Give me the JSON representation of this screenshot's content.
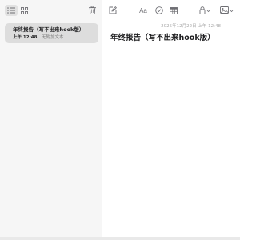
{
  "sidebar": {
    "toolbar": {
      "list_view_icon": "list-icon",
      "gallery_view_icon": "grid-icon",
      "delete_icon": "trash-icon"
    },
    "notes": [
      {
        "title": "年终报告（写不出来hook版）",
        "time": "上午 12:48",
        "preview": "无附加文本"
      }
    ]
  },
  "editor": {
    "toolbar": {
      "icons": [
        "compose-icon",
        "format-text-icon",
        "checklist-icon",
        "table-icon",
        "lock-icon",
        "media-icon"
      ],
      "format_label": "Aa"
    },
    "date_line": "2025年12月22日 上午 12:48",
    "title": "年终报告（写不出来hook版）",
    "body": ""
  },
  "colors": {
    "selection": "#dddddd",
    "sidebar_bg": "#f6f6f6",
    "icon": "#6e6e73"
  }
}
